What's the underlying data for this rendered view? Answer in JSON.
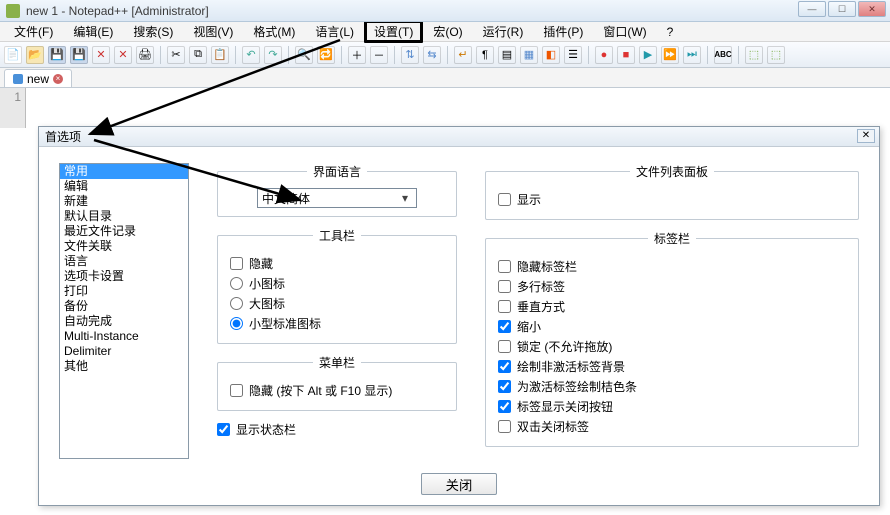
{
  "title": "new 1 - Notepad++ [Administrator]",
  "menu": {
    "file": "文件(F)",
    "edit": "编辑(E)",
    "search": "搜索(S)",
    "view": "视图(V)",
    "format": "格式(M)",
    "language": "语言(L)",
    "settings": "设置(T)",
    "macro": "宏(O)",
    "run": "运行(R)",
    "plugins": "插件(P)",
    "window": "窗口(W)",
    "help": "?"
  },
  "tab_name": "new",
  "line_number": "1",
  "dialog": {
    "title": "首选项",
    "list": [
      "常用",
      "编辑",
      "新建",
      "默认目录",
      "最近文件记录",
      "文件关联",
      "语言",
      "选项卡设置",
      "打印",
      "备份",
      "自动完成",
      "Multi-Instance",
      "Delimiter",
      "其他"
    ],
    "selected_index": 0,
    "lang_group": "界面语言",
    "lang_value": "中文简体",
    "toolbar_group": "工具栏",
    "tb_hide": "隐藏",
    "tb_small": "小图标",
    "tb_large": "大图标",
    "tb_std": "小型标准图标",
    "menubar_group": "菜单栏",
    "menubar_hide": "隐藏 (按下 Alt 或 F10 显示)",
    "show_status": "显示状态栏",
    "filelist_group": "文件列表面板",
    "filelist_show": "显示",
    "tabbar_group": "标签栏",
    "tab_hide": "隐藏标签栏",
    "tab_multi": "多行标签",
    "tab_vertical": "垂直方式",
    "tab_shrink": "缩小",
    "tab_lock": "锁定 (不允许拖放)",
    "tab_inactive_bg": "绘制非激活标签背景",
    "tab_orange_bar": "为激活标签绘制桔色条",
    "tab_close_btn": "标签显示关闭按钮",
    "tab_dblclick": "双击关闭标签",
    "close_btn": "关闭"
  }
}
